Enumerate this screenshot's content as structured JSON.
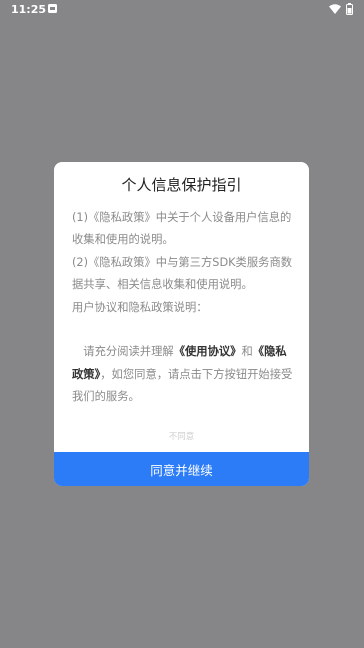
{
  "status_bar": {
    "time": "11:25",
    "notification_icon": "app-notification-icon",
    "wifi_icon": "wifi-icon",
    "battery_icon": "battery-icon"
  },
  "dialog": {
    "title": "个人信息保护指引",
    "lines": [
      "(1)《隐私政策》中关于个人设备用户信息的收集和使用的说明。",
      "(2)《隐私政策》中与第三方SDK类服务商数据共享、相关信息收集和使用说明。",
      "用户协议和隐私政策说明："
    ],
    "notice": {
      "prefix": "请充分阅读并理解",
      "terms_link": "《使用协议》",
      "and": "和",
      "privacy_link": "《隐私政策》",
      "suffix": "，如您同意，请点击下方按钮开始接受我们的服务。"
    },
    "disagree_label": "不同意",
    "agree_label": "同意并继续"
  }
}
